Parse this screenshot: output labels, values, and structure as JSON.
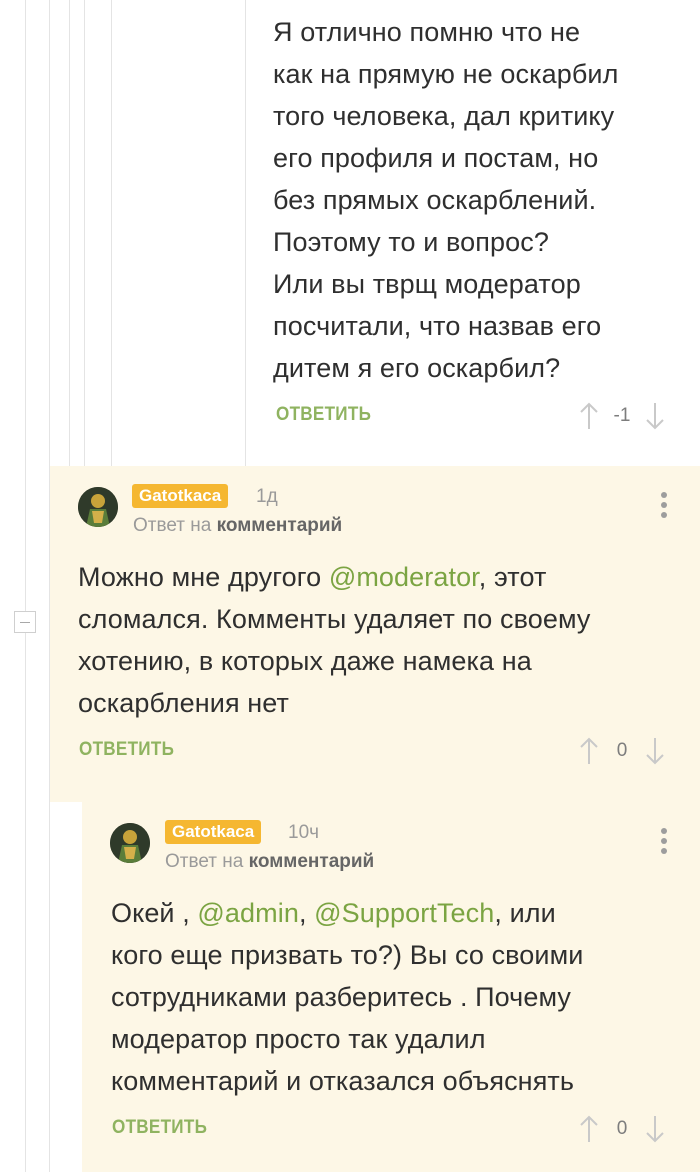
{
  "comment_top": {
    "lines": [
      "Я отлично помню что не",
      "как на прямую не оскарбил",
      "того человека, дал критику",
      "его профиля и постам, но",
      "без прямых оскарблений.",
      "Поэтому то и вопрос?",
      "Или вы тврщ модератор",
      "посчитали, что назвав его",
      "дитем я его оскарбил?"
    ],
    "reply_label": "ОТВЕТИТЬ",
    "score": "-1"
  },
  "comment_1": {
    "username": "Gatotkaca",
    "time": "1д",
    "answer_prefix": "Ответ на",
    "answer_target": "комментарий",
    "text": {
      "line1_a": "Можно мне другого ",
      "mention": "@moderator",
      "line1_b": ", этот",
      "line2": "сломался. Комменты удаляет по своему",
      "line3": "хотению, в которых даже намека на",
      "line4": "оскарбления нет"
    },
    "reply_label": "ОТВЕТИТЬ",
    "score": "0"
  },
  "comment_2": {
    "username": "Gatotkaca",
    "time": "10ч",
    "answer_prefix": "Ответ на",
    "answer_target": "комментарий",
    "text": {
      "line1_a": "Окей , ",
      "mention1": "@admin",
      "line1_b": ", ",
      "mention2": "@SupportTech",
      "line1_c": ", или",
      "line2": "кого еще призвать то?) Вы со своими",
      "line3": "сотрудниками разберитесь . Почему",
      "line4": "модератор просто так удалил",
      "line5": "комментарий и отказался объяснять"
    },
    "reply_label": "ОТВЕТИТЬ",
    "score": "0"
  },
  "colors": {
    "highlight_bg": "#fdf7e6",
    "accent_green": "#8fb360",
    "username_badge": "#f5b731"
  }
}
